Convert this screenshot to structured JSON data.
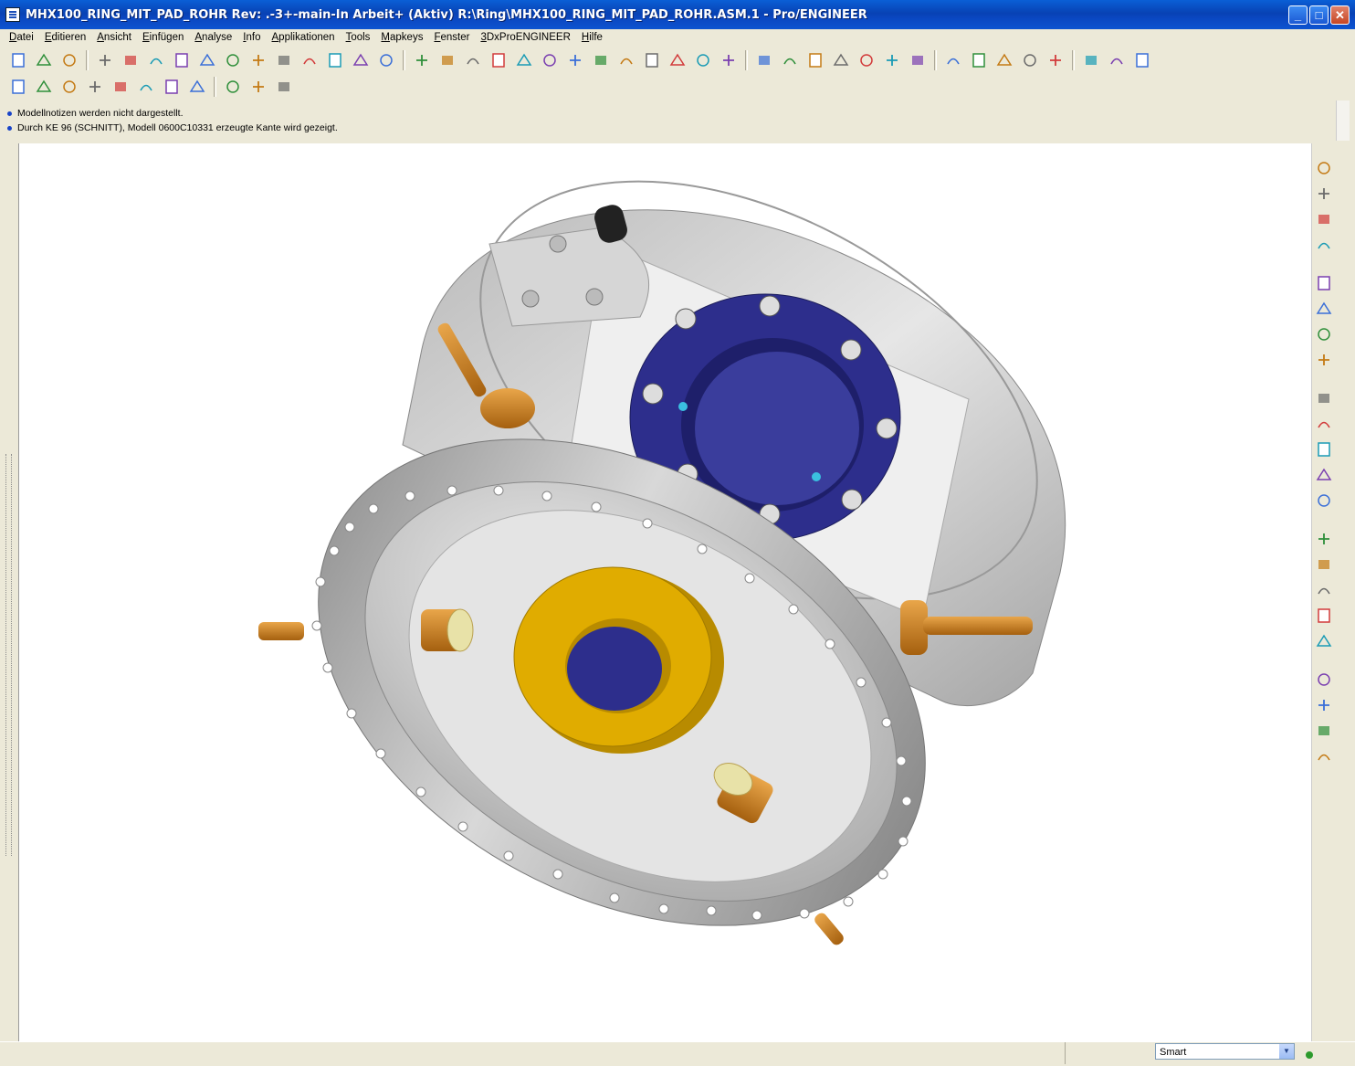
{
  "window": {
    "title": "MHX100_RING_MIT_PAD_ROHR Rev: .-3+-main-In Arbeit+ (Aktiv) R:\\Ring\\MHX100_RING_MIT_PAD_ROHR.ASM.1 - Pro/ENGINEER",
    "minimize": "_",
    "maximize": "□",
    "close": "✕"
  },
  "menu": [
    "Datei",
    "Editieren",
    "Ansicht",
    "Einfügen",
    "Analyse",
    "Info",
    "Applikationen",
    "Tools",
    "Mapkeys",
    "Fenster",
    "3DxProENGINEER",
    "Hilfe"
  ],
  "messages": [
    "Modellnotizen werden nicht dargestellt.",
    "Durch KE 96 (SCHNITT), Modell 0600C10331 erzeugte Kante wird gezeigt."
  ],
  "status": {
    "filter_value": "Smart"
  },
  "toolbar1_icons": [
    "new-icon",
    "open-icon",
    "save-icon",
    "regenerate-icon",
    "edit-icon",
    "undo-icon",
    "redo-icon",
    "copy-icon",
    "paste-icon",
    "paste-special-icon",
    "model-tree-icon",
    "layer-icon",
    "find-icon",
    "select-box-icon",
    "dropdown-icon",
    "datum-icon",
    "spin-center-icon",
    "layers-icon",
    "views-icon",
    "tree-icon",
    "refit-icon",
    "zoom-in-icon",
    "zoom-out-icon",
    "zoom-fit-icon",
    "reorient-icon",
    "saved-views-icon",
    "orient-icon",
    "view-manager-icon",
    "shading-icon",
    "dropdown-icon",
    "color-icon",
    "wireframe-icon",
    "hidden-line-icon",
    "no-hidden-icon",
    "shaded-icon",
    "datum-plane-icon",
    "datum-axis-icon",
    "datum-point-icon",
    "coord-sys-icon",
    "spec-icon",
    "window-activate-icon",
    "window-close-icon",
    "context-help-icon"
  ],
  "toolbar2_icons": [
    "datum-display-icon",
    "sketch-icon",
    "measure-icon",
    "mass-icon",
    "clipboard-icon",
    "filter-icon",
    "table-icon",
    "pie-icon",
    "curve-active-icon",
    "link-icon",
    "monitor-icon"
  ],
  "right_icons": [
    "mirror-icon",
    "rotate-copy-icon",
    "copy-feature-icon",
    "pattern-icon",
    "note-icon",
    "curve-icon",
    "point-icon",
    "datum-tag-icon",
    "plane-icon",
    "axis-icon",
    "sketch-curve-icon",
    "csys-icon",
    "extrude-icon",
    "revolve-icon",
    "sweep-icon",
    "blend-icon",
    "round-icon",
    "chamfer-icon",
    "hole-icon",
    "shell-icon",
    "rib-icon",
    "draft-icon"
  ],
  "colors": {
    "flange": "#2d2e8c",
    "pad": "#e0ac00",
    "bolt": "#c47a14",
    "body": "#d2d2d2",
    "accent_title": "#0842b4"
  }
}
